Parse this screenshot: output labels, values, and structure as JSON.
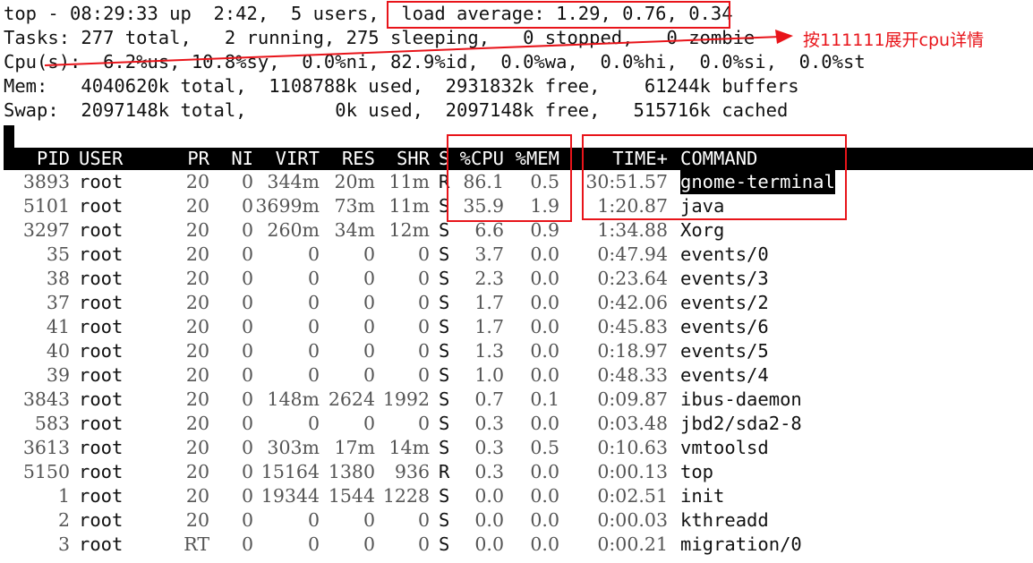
{
  "summary": {
    "line1": "top - 08:29:33 up  2:42,  5 users,  load average: 1.29, 0.76, 0.34",
    "line2": "Tasks: 277 total,   2 running, 275 sleeping,   0 stopped,   0 zombie",
    "line3": "Cpu(s):  6.2%us, 10.8%sy,  0.0%ni, 82.9%id,  0.0%wa,  0.0%hi,  0.0%si,  0.0%st",
    "line4": "Mem:   4040620k total,  1108788k used,  2931832k free,    61244k buffers",
    "line5": "Swap:  2097148k total,        0k used,  2097148k free,   515716k cached"
  },
  "columns": [
    "PID",
    "USER",
    "PR",
    "NI",
    "VIRT",
    "RES",
    "SHR",
    "S",
    "%CPU",
    "%MEM",
    "TIME+",
    "COMMAND"
  ],
  "processes": [
    {
      "pid": "3893",
      "user": "root",
      "pr": "20",
      "ni": "0",
      "virt": "344m",
      "res": "20m",
      "shr": "11m",
      "s": "R",
      "cpu": "86.1",
      "mem": "0.5",
      "time": "30:51.57",
      "command": "gnome-terminal"
    },
    {
      "pid": "5101",
      "user": "root",
      "pr": "20",
      "ni": "0",
      "virt": "3699m",
      "res": "73m",
      "shr": "11m",
      "s": "S",
      "cpu": "35.9",
      "mem": "1.9",
      "time": "1:20.87",
      "command": "java"
    },
    {
      "pid": "3297",
      "user": "root",
      "pr": "20",
      "ni": "0",
      "virt": "260m",
      "res": "34m",
      "shr": "12m",
      "s": "S",
      "cpu": "6.6",
      "mem": "0.9",
      "time": "1:34.88",
      "command": "Xorg"
    },
    {
      "pid": "35",
      "user": "root",
      "pr": "20",
      "ni": "0",
      "virt": "0",
      "res": "0",
      "shr": "0",
      "s": "S",
      "cpu": "3.7",
      "mem": "0.0",
      "time": "0:47.94",
      "command": "events/0"
    },
    {
      "pid": "38",
      "user": "root",
      "pr": "20",
      "ni": "0",
      "virt": "0",
      "res": "0",
      "shr": "0",
      "s": "S",
      "cpu": "2.3",
      "mem": "0.0",
      "time": "0:23.64",
      "command": "events/3"
    },
    {
      "pid": "37",
      "user": "root",
      "pr": "20",
      "ni": "0",
      "virt": "0",
      "res": "0",
      "shr": "0",
      "s": "S",
      "cpu": "1.7",
      "mem": "0.0",
      "time": "0:42.06",
      "command": "events/2"
    },
    {
      "pid": "41",
      "user": "root",
      "pr": "20",
      "ni": "0",
      "virt": "0",
      "res": "0",
      "shr": "0",
      "s": "S",
      "cpu": "1.7",
      "mem": "0.0",
      "time": "0:45.83",
      "command": "events/6"
    },
    {
      "pid": "40",
      "user": "root",
      "pr": "20",
      "ni": "0",
      "virt": "0",
      "res": "0",
      "shr": "0",
      "s": "S",
      "cpu": "1.3",
      "mem": "0.0",
      "time": "0:18.97",
      "command": "events/5"
    },
    {
      "pid": "39",
      "user": "root",
      "pr": "20",
      "ni": "0",
      "virt": "0",
      "res": "0",
      "shr": "0",
      "s": "S",
      "cpu": "1.0",
      "mem": "0.0",
      "time": "0:48.33",
      "command": "events/4"
    },
    {
      "pid": "3843",
      "user": "root",
      "pr": "20",
      "ni": "0",
      "virt": "148m",
      "res": "2624",
      "shr": "1992",
      "s": "S",
      "cpu": "0.7",
      "mem": "0.1",
      "time": "0:09.87",
      "command": "ibus-daemon"
    },
    {
      "pid": "583",
      "user": "root",
      "pr": "20",
      "ni": "0",
      "virt": "0",
      "res": "0",
      "shr": "0",
      "s": "S",
      "cpu": "0.3",
      "mem": "0.0",
      "time": "0:03.48",
      "command": "jbd2/sda2-8"
    },
    {
      "pid": "3613",
      "user": "root",
      "pr": "20",
      "ni": "0",
      "virt": "303m",
      "res": "17m",
      "shr": "14m",
      "s": "S",
      "cpu": "0.3",
      "mem": "0.5",
      "time": "0:10.63",
      "command": "vmtoolsd"
    },
    {
      "pid": "5150",
      "user": "root",
      "pr": "20",
      "ni": "0",
      "virt": "15164",
      "res": "1380",
      "shr": "936",
      "s": "R",
      "cpu": "0.3",
      "mem": "0.0",
      "time": "0:00.13",
      "command": "top"
    },
    {
      "pid": "1",
      "user": "root",
      "pr": "20",
      "ni": "0",
      "virt": "19344",
      "res": "1544",
      "shr": "1228",
      "s": "S",
      "cpu": "0.0",
      "mem": "0.0",
      "time": "0:02.51",
      "command": "init"
    },
    {
      "pid": "2",
      "user": "root",
      "pr": "20",
      "ni": "0",
      "virt": "0",
      "res": "0",
      "shr": "0",
      "s": "S",
      "cpu": "0.0",
      "mem": "0.0",
      "time": "0:00.03",
      "command": "kthreadd"
    },
    {
      "pid": "3",
      "user": "root",
      "pr": "RT",
      "ni": "0",
      "virt": "0",
      "res": "0",
      "shr": "0",
      "s": "S",
      "cpu": "0.0",
      "mem": "0.0",
      "time": "0:00.21",
      "command": "migration/0"
    }
  ],
  "annotation": {
    "text": "按111111展开cpu详情",
    "color": "#e8141a"
  }
}
